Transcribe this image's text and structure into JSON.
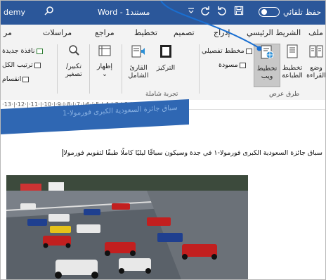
{
  "title_bar": {
    "left_text": "demy",
    "app_title": "Word - مستند1",
    "autosave_label": "حفظ تلقائي",
    "search_icon": "search-icon",
    "save_icon": "save-icon",
    "undo_icon": "undo-icon",
    "redo_icon": "redo-icon",
    "customize_icon": "chevron-down-icon"
  },
  "tabs": [
    {
      "label": "ملف"
    },
    {
      "label": "الشريط الرئيسي"
    },
    {
      "label": "إدراج"
    },
    {
      "label": "تصميم"
    },
    {
      "label": "تخطيط"
    },
    {
      "label": "مراجع"
    },
    {
      "label": "مراسلات"
    },
    {
      "label": "مر"
    }
  ],
  "ribbon": {
    "views": {
      "group_label": "طرق عرض",
      "read_mode": "وضع القراءة",
      "print_layout": "تخطيط الطباعة",
      "web_layout": "تخطيط ويب",
      "outline": "مخطط تفصيلي",
      "draft": "مسودة"
    },
    "immersive": {
      "group_label": "تجربة شاملة",
      "focus": "التركيز",
      "immersive_reader": "القارئ الشامل"
    },
    "show": {
      "label": "إظهار"
    },
    "zoom": {
      "label": "تكبير/ تصغير"
    },
    "window": {
      "new_window": "نافذة جديدة",
      "arrange_all": "ترتيب الكل",
      "split": "انقسام"
    }
  },
  "ruler": {
    "marks": "·13·|·12·|·11·|·10·|·9·|·8·|·7·|·6·|·5·|·4·|·3·|·2·|·1·|"
  },
  "document": {
    "banner_text": "سباق جائزة السعودية الكبرى فورمولا-1",
    "paragraph": "سباق جائزة السعودية الكبرى فورمولا-١ في جدة وسيكون سباقًا ليليًا كاملًا طبقًا لتقويم فورمولا"
  },
  "colors": {
    "accent": "#2b579a",
    "banner": "#2f67b3",
    "annotation": "#1a6fd1"
  }
}
